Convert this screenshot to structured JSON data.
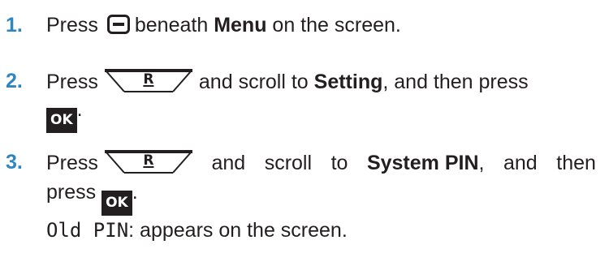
{
  "steps": [
    {
      "number": "1.",
      "text_before": "Press",
      "key_icon": "softkey-icon",
      "text_middle": "beneath",
      "bold": "Menu",
      "text_after": "on the screen."
    },
    {
      "number": "2.",
      "text_before": "Press",
      "key_icon": "r-scroll-key-icon",
      "key_label": "R",
      "text_middle": "and scroll to",
      "bold": "Setting",
      "text_after": ", and then press",
      "ok_label": "OK",
      "end": "."
    },
    {
      "number": "3.",
      "text_before": "Press",
      "key_icon": "r-scroll-key-icon",
      "key_label": "R",
      "text_middle_1": "and",
      "text_middle_2": "scroll",
      "text_middle_3": "to",
      "bold": "System PIN",
      "text_after_1": ",",
      "text_after_2": "and",
      "text_after_3": "then",
      "line2_text": "press",
      "ok_label": "OK",
      "end": "."
    }
  ],
  "note": {
    "screen_text": "Old PIN",
    "text_after": ": appears on the screen."
  }
}
